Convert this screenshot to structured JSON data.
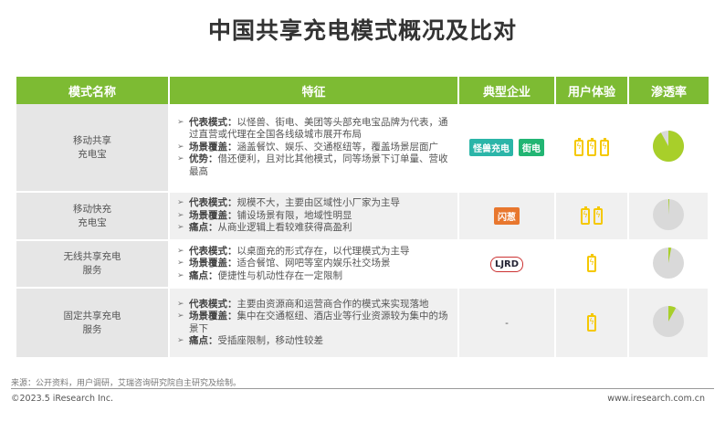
{
  "title": "中国共享充电模式概况及比对",
  "headers": [
    "模式名称",
    "特征",
    "典型企业",
    "用户体验",
    "渗透率"
  ],
  "rows": [
    {
      "mode": [
        "移动共享",
        "充电宝"
      ],
      "features": [
        {
          "k": "代表模式：",
          "v": "以怪兽、街电、美团等头部充电宝品牌为代表，通过直营或代理在全国各线级城市展开布局"
        },
        {
          "k": "场景覆盖：",
          "v": "涵盖餐饮、娱乐、交通枢纽等，覆盖场景层面广"
        },
        {
          "k": "优势：",
          "v": "借还便利，且对比其他模式，同等场景下订单量、营收最高"
        }
      ],
      "companies": [
        "怪兽充电",
        "街电"
      ],
      "experience": 3,
      "penetration": 0.92
    },
    {
      "mode": [
        "移动快充",
        "充电宝"
      ],
      "features": [
        {
          "k": "代表模式：",
          "v": "规模不大，主要由区域性小厂家为主导"
        },
        {
          "k": "场景覆盖：",
          "v": "铺设场景有限，地域性明显"
        },
        {
          "k": "痛点：",
          "v": "从商业逻辑上看较难获得高盈利"
        }
      ],
      "companies": [
        "闪葱"
      ],
      "experience": 2,
      "penetration": 0.01
    },
    {
      "mode": [
        "无线共享充电",
        "服务"
      ],
      "features": [
        {
          "k": "代表模式：",
          "v": "以桌面充的形式存在，以代理模式为主导"
        },
        {
          "k": "场景覆盖：",
          "v": "适合餐馆、网吧等室内娱乐社交场景"
        },
        {
          "k": "痛点：",
          "v": "便捷性与机动性存在一定限制"
        }
      ],
      "companies": [
        "LJRD"
      ],
      "experience": 1,
      "penetration": 0.03
    },
    {
      "mode": [
        "固定共享充电",
        "服务"
      ],
      "features": [
        {
          "k": "代表模式：",
          "v": "主要由资源商和运营商合作的模式来实现落地"
        },
        {
          "k": "场景覆盖：",
          "v": "集中在交通枢纽、酒店业等行业资源较为集中的场景下"
        },
        {
          "k": "痛点：",
          "v": "受插座限制，移动性较差"
        }
      ],
      "companies": [
        "-"
      ],
      "experience": 1,
      "penetration": 0.08
    }
  ],
  "colors": {
    "header": "#7dbb33",
    "pie_fill": "#a8cf2a",
    "pie_bg": "#d9d9d9",
    "battery": "#f5c800"
  },
  "footer": {
    "source": "来源：公开资料，用户调研，艾瑞咨询研究院自主研究及绘制。",
    "copyright": "©2023.5 iResearch Inc.",
    "url": "www.iresearch.com.cn"
  }
}
